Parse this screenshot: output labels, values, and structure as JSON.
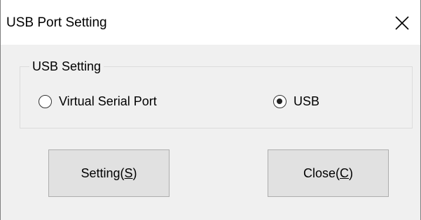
{
  "window": {
    "title": "USB Port Setting",
    "close_glyph": "close-icon"
  },
  "usb_setting": {
    "legend": "USB Setting",
    "options": [
      {
        "label": "Virtual Serial Port",
        "checked": false
      },
      {
        "label": "USB",
        "checked": true
      }
    ]
  },
  "buttons": {
    "setting": {
      "prefix": "Setting(",
      "mnemonic": "S",
      "suffix": ")"
    },
    "close": {
      "prefix": "Close(",
      "mnemonic": "C",
      "suffix": ")"
    }
  },
  "colors": {
    "face": "#f0f0f0",
    "button_face": "#e1e1e1",
    "button_border": "#adadad",
    "titlebar": "#ffffff"
  }
}
